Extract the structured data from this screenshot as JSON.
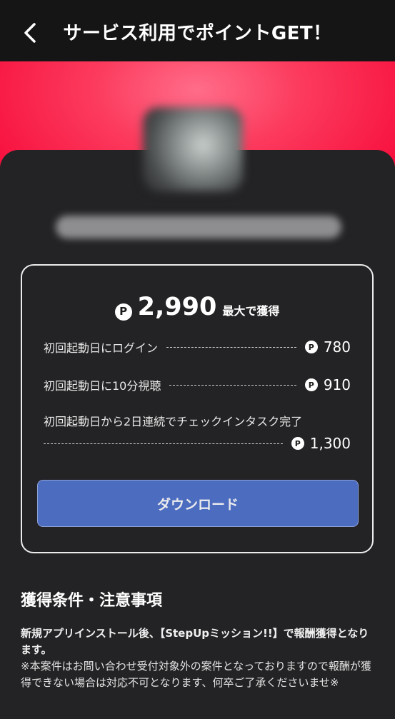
{
  "header": {
    "title": "サービス利用でポイントGET！",
    "back_icon": "chevron-left-icon"
  },
  "colors": {
    "hero": "#f7113e",
    "button": "#4c6cc0",
    "background": "#232325"
  },
  "reward": {
    "coin_symbol": "P",
    "total": "2,990",
    "total_label": "最大で獲得",
    "items": [
      {
        "label": "初回起動日にログイン",
        "points": "780"
      },
      {
        "label": "初回起動日に10分視聴",
        "points": "910"
      },
      {
        "label": "初回起動日から2日連続でチェックインタスク完了",
        "points": "1,300"
      }
    ],
    "download_label": "ダウンロード"
  },
  "notes": {
    "title": "獲得条件・注意事項",
    "bold_text": "新規アプリインストール後、【StepUpミッション!!】で報酬獲得となります。",
    "normal_text": "※本案件はお問い合わせ受付対象外の案件となっておりますので報酬が獲得できない場合は対応不可となります、何卒ご了承くださいませ※"
  }
}
